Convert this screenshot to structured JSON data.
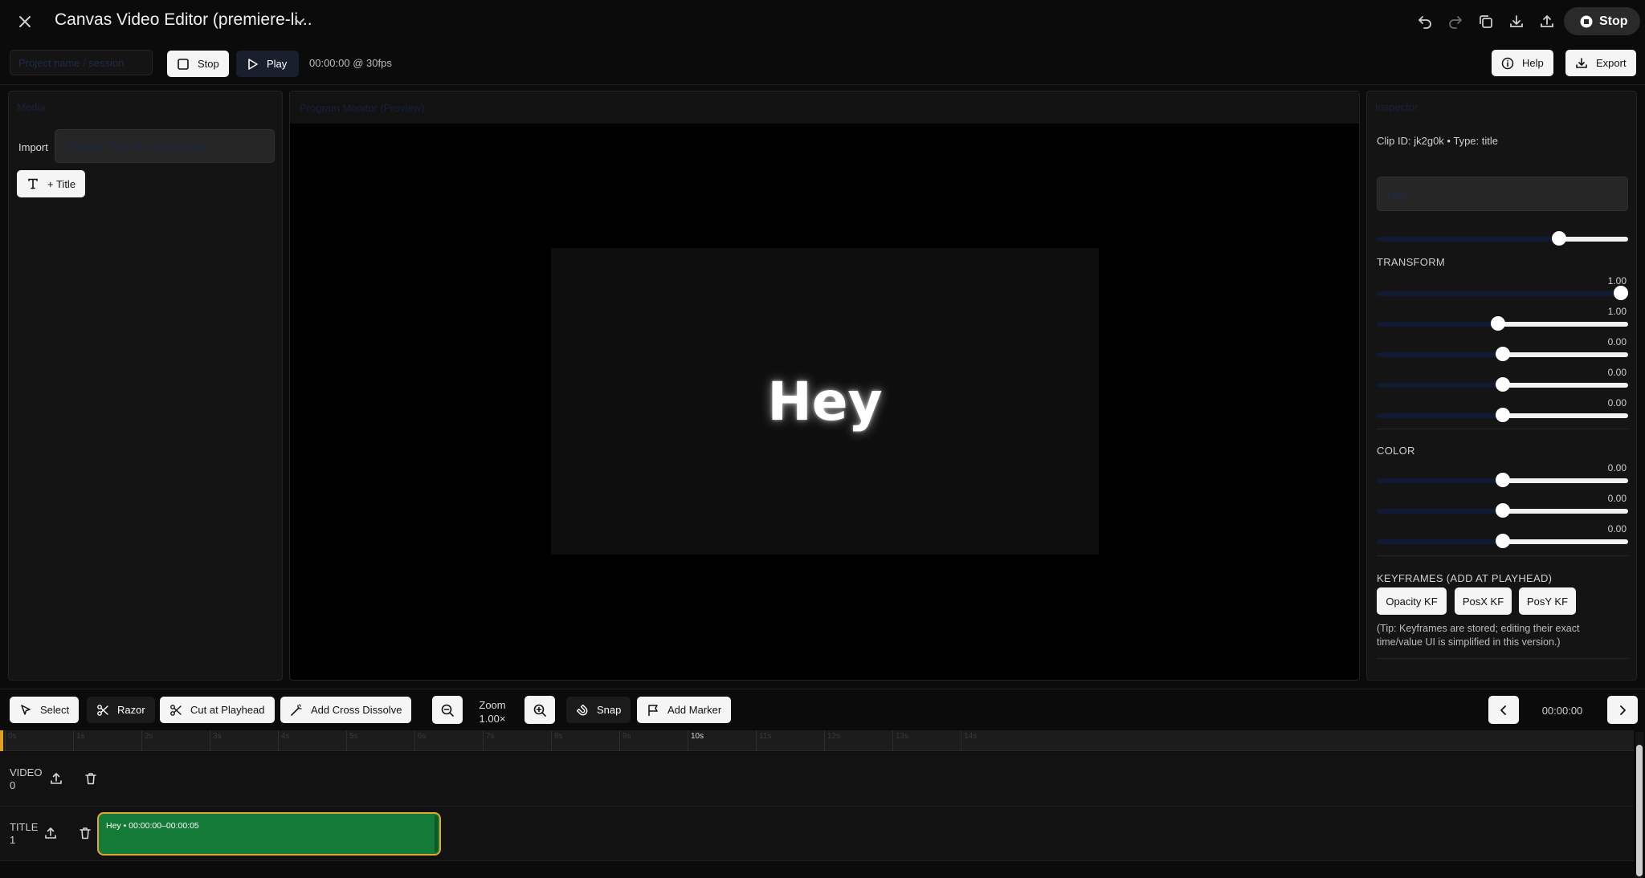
{
  "app": {
    "title": "Canvas Video Editor (premiere-li...",
    "top_stop_label": "Stop"
  },
  "toolbar": {
    "project_placeholder": "Project name / session",
    "stop_label": "Stop",
    "play_label": "Play",
    "timecode_fps": "00:00:00 @ 30fps",
    "help_label": "Help",
    "export_label": "Export"
  },
  "media": {
    "header": "Media",
    "import_label": "Import",
    "choose_files": "Choose Files",
    "no_file": "No file chosen",
    "add_title_label": "+ Title"
  },
  "preview": {
    "header": "Program Monitor (Preview)",
    "stage_text": "Hey"
  },
  "inspector": {
    "header": "Inspector",
    "clip_meta": "Clip ID: jk2g0k • Type: title",
    "text_value": "Hey",
    "opacity": {
      "fraction": 0.74
    },
    "transform_label": "TRANSFORM",
    "transform": [
      {
        "value": "1.00",
        "fraction": 1.0
      },
      {
        "value": "1.00",
        "fraction": 0.48
      },
      {
        "value": "0.00",
        "fraction": 0.5
      },
      {
        "value": "0.00",
        "fraction": 0.5
      },
      {
        "value": "0.00",
        "fraction": 0.5
      }
    ],
    "color_label": "COLOR",
    "color": [
      {
        "value": "0.00",
        "fraction": 0.5
      },
      {
        "value": "0.00",
        "fraction": 0.5
      },
      {
        "value": "0.00",
        "fraction": 0.5
      }
    ],
    "keyframes_label": "KEYFRAMES (ADD AT PLAYHEAD)",
    "kf_buttons": [
      "Opacity KF",
      "PosX KF",
      "PosY KF"
    ],
    "tip": "(Tip: Keyframes are stored; editing their exact time/value UI is simplified in this version.)"
  },
  "timeline_toolbar": {
    "select_label": "Select",
    "razor_label": "Razor",
    "cut_label": "Cut at Playhead",
    "dissolve_label": "Add Cross Dissolve",
    "zoom_label": "Zoom",
    "zoom_value": "1.00×",
    "snap_label": "Snap",
    "marker_label": "Add Marker",
    "timecode": "00:00:00"
  },
  "timeline": {
    "ticks": [
      "0s",
      "1s",
      "2s",
      "3s",
      "4s",
      "5s",
      "6s",
      "7s",
      "8s",
      "9s",
      "10s",
      "11s",
      "12s",
      "13s",
      "14s"
    ],
    "active_tick": "10s",
    "tracks": [
      {
        "name": "VIDEO",
        "index": "0"
      },
      {
        "name": "TITLE",
        "index": "1"
      }
    ],
    "clip_label": "Hey • 00:00:00–00:00:05"
  },
  "colors": {
    "clip_fill": "#137a38",
    "clip_border": "#e3a72f",
    "playhead": "#e0a020"
  }
}
